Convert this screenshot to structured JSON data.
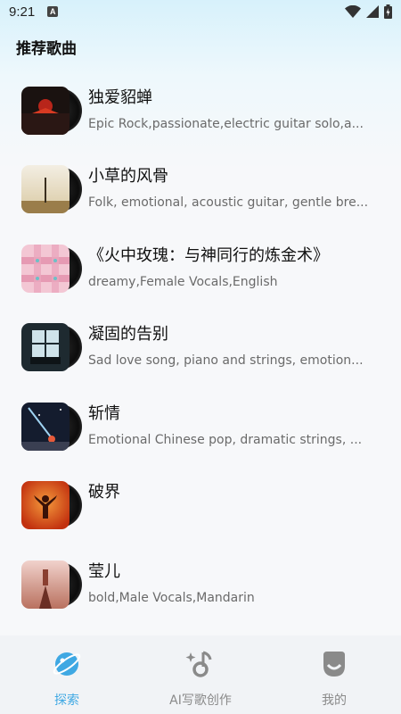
{
  "status_bar": {
    "time": "9:21",
    "badge": "A"
  },
  "header": {
    "title": "推荐歌曲"
  },
  "songs": [
    {
      "title": "独爱貂蝉",
      "description": "Epic Rock,passionate,electric guitar solo,a..."
    },
    {
      "title": "小草的风骨",
      "description": "Folk, emotional, acoustic guitar, gentle bre..."
    },
    {
      "title": "《火中玫瑰：与神同行的炼金术》",
      "description": "dreamy,Female Vocals,English"
    },
    {
      "title": "凝固的告别",
      "description": "Sad love song, piano and strings, emotion..."
    },
    {
      "title": "斩情",
      "description": "Emotional Chinese pop, dramatic strings, ..."
    },
    {
      "title": "破界",
      "description": ""
    },
    {
      "title": "莹儿",
      "description": "bold,Male Vocals,Mandarin"
    }
  ],
  "bottom_nav": {
    "tabs": [
      {
        "label": "探索",
        "icon": "explore-planet-icon",
        "active": true
      },
      {
        "label": "AI写歌创作",
        "icon": "music-note-sparkle-icon",
        "active": false
      },
      {
        "label": "我的",
        "icon": "profile-face-icon",
        "active": false
      }
    ]
  },
  "colors": {
    "accent": "#3fa8e3",
    "inactive": "#8a8a8a",
    "nav_bg": "#f1f3f6"
  }
}
